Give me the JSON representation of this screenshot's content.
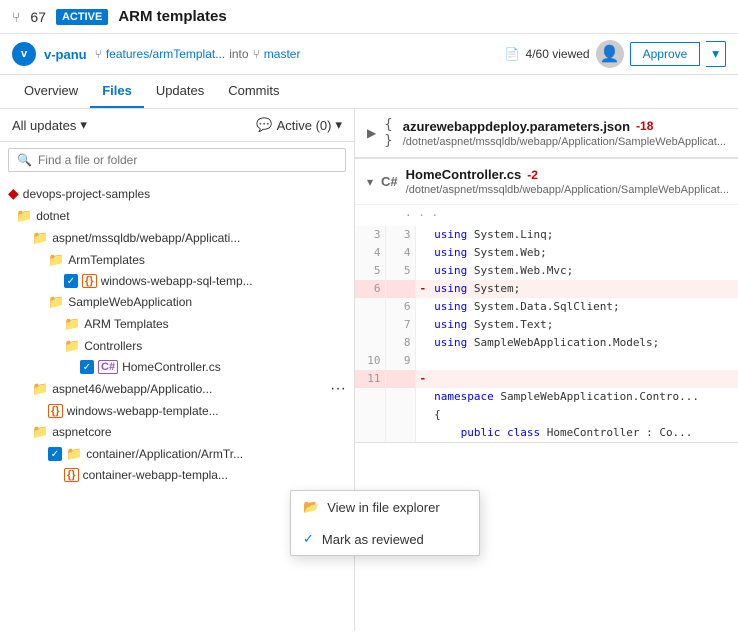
{
  "topBar": {
    "prIcon": "⑂",
    "prCount": "67",
    "activeBadge": "ACTIVE",
    "prTitle": "ARM templates"
  },
  "authorBar": {
    "authorInitial": "v",
    "authorName": "v-panu",
    "branchFrom": "features/armTemplat...",
    "intoText": "into",
    "branchTo": "master",
    "viewedText": "4/60 viewed",
    "approveLabel": "Approve"
  },
  "navTabs": {
    "tabs": [
      {
        "label": "Overview",
        "active": false
      },
      {
        "label": "Files",
        "active": true
      },
      {
        "label": "Updates",
        "active": false
      },
      {
        "label": "Commits",
        "active": false
      }
    ]
  },
  "fileTreeHeader": {
    "allUpdatesLabel": "All updates",
    "activeFilterLabel": "Active (0)"
  },
  "searchBox": {
    "placeholder": "Find a file or folder"
  },
  "fileTree": {
    "rootName": "devops-project-samples",
    "items": [
      {
        "id": "dotnet",
        "label": "dotnet",
        "type": "folder",
        "indent": 1
      },
      {
        "id": "aspnet-webapp",
        "label": "aspnet/mssqldb/webapp/Applicati...",
        "type": "folder",
        "indent": 2
      },
      {
        "id": "armtemplates",
        "label": "ArmTemplates",
        "type": "folder",
        "indent": 3
      },
      {
        "id": "windows-webapp-sql",
        "label": "windows-webapp-sql-temp...",
        "type": "json",
        "indent": 4,
        "checked": true
      },
      {
        "id": "samplewebapp",
        "label": "SampleWebApplication",
        "type": "folder",
        "indent": 3
      },
      {
        "id": "arm-templates-folder",
        "label": "ARM Templates",
        "type": "folder",
        "indent": 4
      },
      {
        "id": "controllers",
        "label": "Controllers",
        "type": "folder",
        "indent": 4
      },
      {
        "id": "homecontroller",
        "label": "HomeController.cs",
        "type": "cs",
        "indent": 5,
        "checked": true
      },
      {
        "id": "aspnet46-webapp",
        "label": "aspnet46/webapp/Applicatio...",
        "type": "folder",
        "indent": 2,
        "hasContextMenu": true
      },
      {
        "id": "windows-webapp-template",
        "label": "windows-webapp-template...",
        "type": "json",
        "indent": 3
      },
      {
        "id": "aspnetcore",
        "label": "aspnetcore",
        "type": "folder",
        "indent": 2
      },
      {
        "id": "container-app-arm",
        "label": "container/Application/ArmTr...",
        "type": "folder",
        "indent": 3,
        "checked": true
      },
      {
        "id": "container-webapp-template",
        "label": "container-webapp-templa...",
        "type": "json",
        "indent": 4
      }
    ]
  },
  "contextMenu": {
    "items": [
      {
        "label": "View in file explorer",
        "icon": "folder-icon",
        "hasCheck": false
      },
      {
        "label": "Mark as reviewed",
        "icon": "check-icon",
        "hasCheck": true
      }
    ]
  },
  "codePanel": {
    "sections": [
      {
        "id": "json-section",
        "collapsed": true,
        "icon": "{}",
        "fileName": "azurewebappdeploy.parameters.json",
        "diffCount": "-18",
        "filePath": "/dotnet/aspnet/mssqldb/webapp/Application/SampleWebApplicat..."
      },
      {
        "id": "cs-section",
        "collapsed": false,
        "lang": "C#",
        "fileName": "HomeController.cs",
        "diffCount": "-2",
        "filePath": "/dotnet/aspnet/mssqldb/webapp/Application/SampleWebApplicat...",
        "dotsRow": "· · ·",
        "lines": [
          {
            "oldNum": "3",
            "newNum": "3",
            "marker": "",
            "content": "    <span class='keyword'>using</span> System.Linq;",
            "deleted": false
          },
          {
            "oldNum": "4",
            "newNum": "4",
            "marker": "",
            "content": "    <span class='keyword'>using</span> System.Web;",
            "deleted": false
          },
          {
            "oldNum": "5",
            "newNum": "5",
            "marker": "",
            "content": "    <span class='keyword'>using</span> System.Web.Mvc;",
            "deleted": false
          },
          {
            "oldNum": "6",
            "newNum": "",
            "marker": "-",
            "content": "    <span class='keyword'>using</span> System;",
            "deleted": true
          },
          {
            "oldNum": "",
            "newNum": "6",
            "marker": "",
            "content": "    <span class='keyword'>using</span> System.Data.SqlClient;",
            "deleted": false
          },
          {
            "oldNum": "",
            "newNum": "7",
            "marker": "",
            "content": "    <span class='keyword'>using</span> System.Text;",
            "deleted": false
          },
          {
            "oldNum": "",
            "newNum": "8",
            "marker": "",
            "content": "    <span class='keyword'>using</span> SampleWebApplication.Models;",
            "deleted": false
          },
          {
            "oldNum": "10",
            "newNum": "9",
            "marker": "",
            "content": "",
            "deleted": false
          },
          {
            "oldNum": "11",
            "newNum": "",
            "marker": "-",
            "content": "",
            "deleted": true
          },
          {
            "oldNum": "",
            "newNum": "",
            "marker": "",
            "content": "    <span class='keyword'>namespace</span> SampleWebApplication.Contro...",
            "deleted": false
          },
          {
            "oldNum": "",
            "newNum": "",
            "marker": "",
            "content": "    {",
            "deleted": false
          },
          {
            "oldNum": "",
            "newNum": "",
            "marker": "",
            "content": "        <span class='keyword'>public class</span> HomeController : Co...",
            "deleted": false
          }
        ]
      }
    ]
  }
}
